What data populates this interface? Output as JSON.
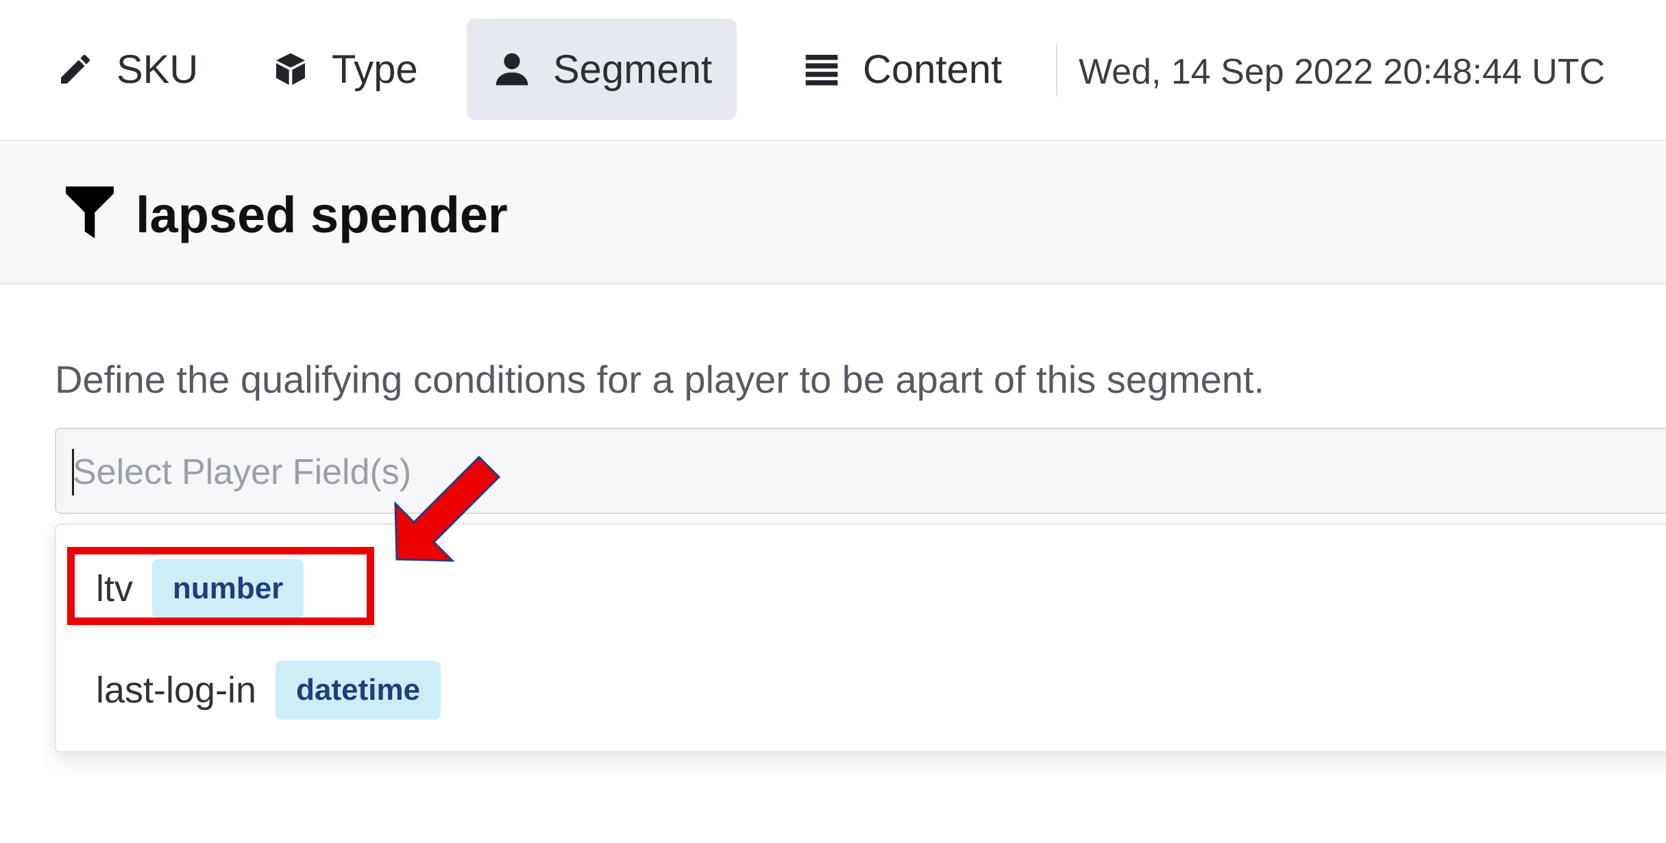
{
  "nav": {
    "tabs": [
      {
        "label": "SKU",
        "icon": "pencil-icon"
      },
      {
        "label": "Type",
        "icon": "cube-icon"
      },
      {
        "label": "Segment",
        "icon": "user-icon",
        "active": true
      },
      {
        "label": "Content",
        "icon": "list-icon"
      }
    ],
    "timestamp": "Wed, 14 Sep 2022 20:48:44 UTC"
  },
  "header": {
    "icon": "filter-icon",
    "title": "lapsed spender"
  },
  "main": {
    "description": "Define the qualifying conditions for a player to be apart of this segment.",
    "select": {
      "placeholder": "Select Player Field(s)",
      "value": ""
    },
    "options": [
      {
        "name": "ltv",
        "type": "number"
      },
      {
        "name": "last-log-in",
        "type": "datetime"
      }
    ]
  },
  "annotation": {
    "highlight_color": "#ee0000",
    "arrow_color": "#ee0000",
    "arrow_outline": "#1f3c88"
  },
  "colors": {
    "active_tab_bg": "#e6e9f0",
    "badge_bg": "#cdeef6",
    "badge_text": "#1d3f7e"
  }
}
